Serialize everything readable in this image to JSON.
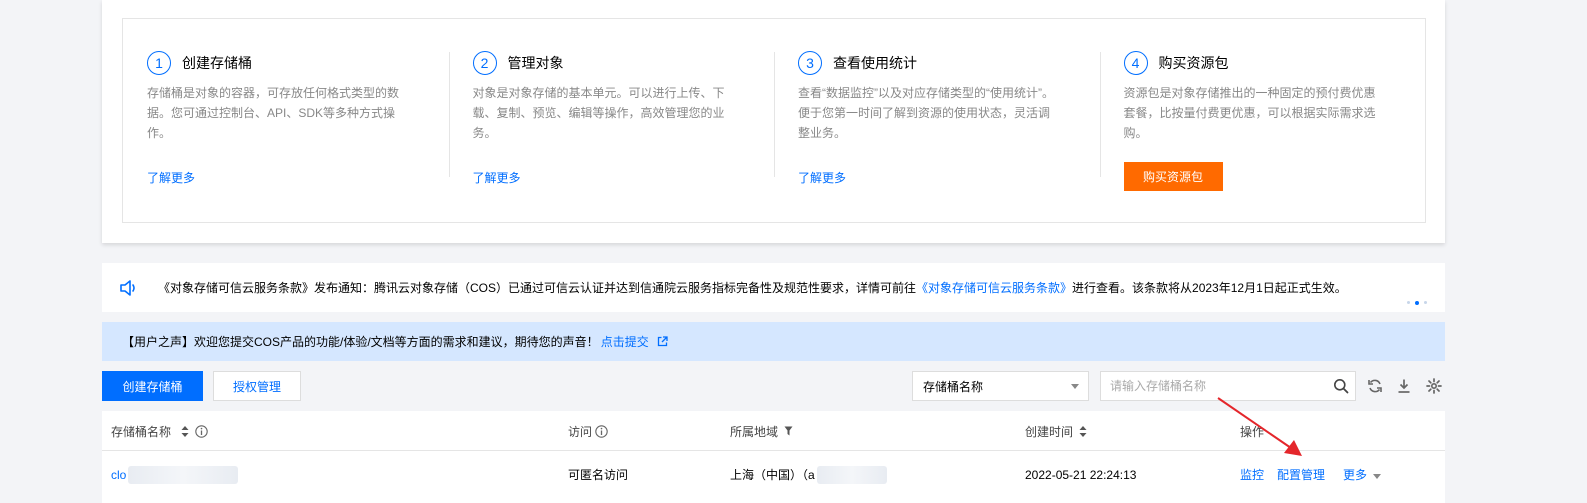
{
  "steps": [
    {
      "num": "1",
      "title": "创建存储桶",
      "desc": "存储桶是对象的容器，可存放任何格式类型的数据。您可通过控制台、API、SDK等多种方式操作。",
      "action": "了解更多"
    },
    {
      "num": "2",
      "title": "管理对象",
      "desc": "对象是对象存储的基本单元。可以进行上传、下载、复制、预览、编辑等操作，高效管理您的业务。",
      "action": "了解更多"
    },
    {
      "num": "3",
      "title": "查看使用统计",
      "desc": "查看“数据监控”以及对应存储类型的“使用统计”。便于您第一时间了解到资源的使用状态，灵活调整业务。",
      "action": "了解更多"
    },
    {
      "num": "4",
      "title": "购买资源包",
      "desc": "资源包是对象存储推出的一种固定的预付费优惠套餐，比按量付费更优惠，可以根据实际需求选购。",
      "action": "购买资源包"
    }
  ],
  "notice": {
    "before": "《对象存储可信云服务条款》发布通知：腾讯云对象存储（COS）已通过可信云认证并达到信通院云服务指标完备性及规范性要求，详情可前往",
    "link": "《对象存储可信云服务条款》",
    "after": "进行查看。该条款将从2023年12月1日起正式生效。"
  },
  "feedback": {
    "text": "【用户之声】欢迎您提交COS产品的功能/体验/文档等方面的需求和建议，期待您的声音！",
    "link": "点击提交"
  },
  "toolbar": {
    "create_label": "创建存储桶",
    "auth_label": "授权管理",
    "select_value": "存储桶名称",
    "search_placeholder": "请输入存储桶名称"
  },
  "table": {
    "headers": {
      "name": "存储桶名称",
      "access": "访问",
      "region": "所属地域",
      "created": "创建时间",
      "ops": "操作"
    },
    "rows": [
      {
        "name_prefix": "clo",
        "access": "可匿名访问",
        "region": "上海（中国）（a",
        "created": "2022-05-21 22:24:13",
        "ops": {
          "monitor": "监控",
          "config": "配置管理",
          "more": "更多"
        }
      }
    ]
  },
  "colors": {
    "primary": "#006eff",
    "orange": "#ff6a00",
    "banner": "#d5e7ff",
    "annotation_arrow": "#e4262b"
  }
}
